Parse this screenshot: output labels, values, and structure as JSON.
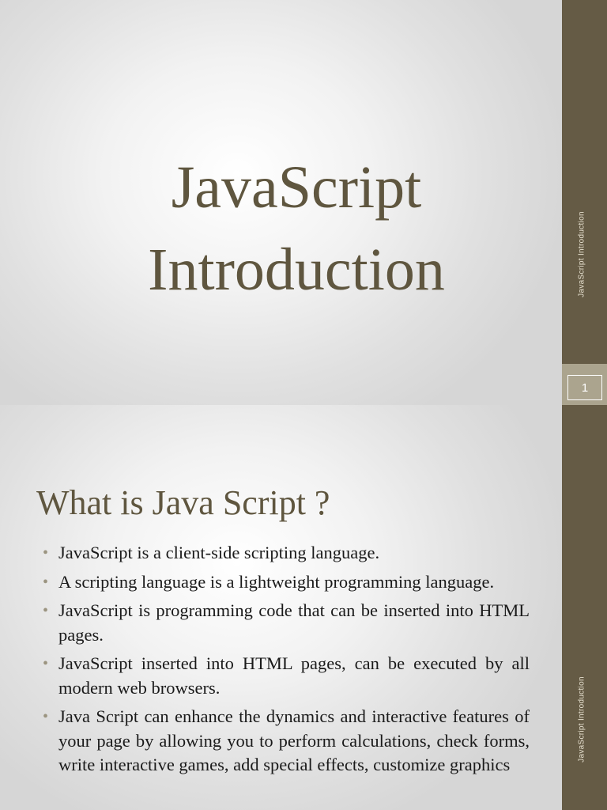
{
  "slides": [
    {
      "title_line1": "JavaScript",
      "title_line2": "Introduction",
      "side_label": "JavaScript Introduction",
      "slide_number": "1"
    },
    {
      "heading": "What is Java Script ?",
      "side_label": "JavaScript Introduction",
      "bullets": [
        "JavaScript is a client-side scripting language.",
        "A scripting language is a lightweight programming language.",
        "JavaScript is programming code that can be inserted into HTML pages.",
        "JavaScript inserted into HTML pages, can be executed by all modern web browsers.",
        "Java Script can enhance the dynamics and interactive features of your page by allowing you to perform calculations, check forms, write interactive games, add special effects, customize graphics"
      ]
    }
  ],
  "colors": {
    "sidebar": "#655b45",
    "title_text": "#5f563f",
    "number_band": "#aba48e"
  }
}
